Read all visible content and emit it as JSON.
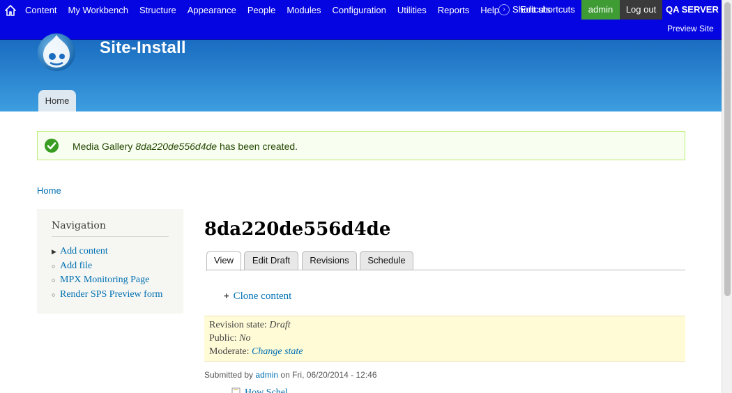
{
  "toolbar": {
    "menu": [
      "Content",
      "My Workbench",
      "Structure",
      "Appearance",
      "People",
      "Modules",
      "Configuration",
      "Utilities",
      "Reports",
      "Help"
    ],
    "shortcuts_label": "Shortcuts",
    "edit_shortcuts_label": "Edit shortcuts",
    "user_label": "admin",
    "logout_label": "Log out",
    "server_label": "QA SERVER",
    "preview_label": "Preview Site"
  },
  "header": {
    "site_name": "Site-Install",
    "home_tab": "Home"
  },
  "status": {
    "prefix": "Media Gallery",
    "title": "8da220de556d4de",
    "suffix": "has been created."
  },
  "breadcrumb": "Home",
  "sidebar": {
    "title": "Navigation",
    "items": [
      "Add content",
      "Add file",
      "MPX Monitoring Page",
      "Render SPS Preview form"
    ]
  },
  "page": {
    "title": "8da220de556d4de",
    "tabs": [
      "View",
      "Edit Draft",
      "Revisions",
      "Schedule"
    ],
    "clone_label": "Clone content",
    "revision": {
      "state_label": "Revision state:",
      "state_value": "Draft",
      "public_label": "Public:",
      "public_value": "No",
      "moderate_label": "Moderate:",
      "moderate_value": "Change state"
    },
    "submitted": {
      "prefix": "Submitted by",
      "user": "admin",
      "date": "on Fri, 06/20/2014 - 12:46"
    },
    "partial_link": "How Schel..."
  },
  "colors": {
    "toolbar": "#0505e1",
    "header_top": "#1a6cc0",
    "header_bottom": "#3d9ee0",
    "link": "#0071b3",
    "admin": "#3f9c35",
    "logout": "#3a3a3a"
  }
}
